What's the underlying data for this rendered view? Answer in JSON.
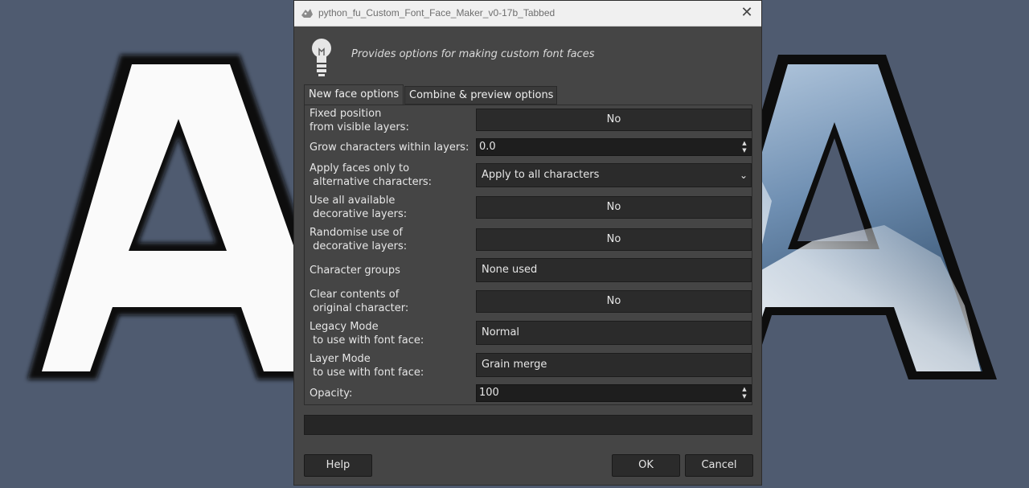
{
  "window": {
    "title": "python_fu_Custom_Font_Face_Maker_v0-17b_Tabbed",
    "close_glyph": "✕"
  },
  "header": {
    "description": "Provides options for making custom font faces"
  },
  "tabs": [
    {
      "label": "New face options",
      "active": true
    },
    {
      "label": "Combine & preview options",
      "active": false
    }
  ],
  "form": {
    "fixed_position": {
      "label": "Fixed position\nfrom visible layers:",
      "value": "No"
    },
    "grow_characters": {
      "label": "Grow characters within layers:",
      "value": "0.0"
    },
    "apply_faces": {
      "label": "Apply faces only to\n alternative characters:",
      "value": "Apply to all characters"
    },
    "use_all_decorative": {
      "label": "Use all available\n decorative layers:",
      "value": "No"
    },
    "randomise_decorative": {
      "label": "Randomise use of\n decorative layers:",
      "value": "No"
    },
    "character_groups": {
      "label": "Character groups",
      "value": "None used"
    },
    "clear_contents": {
      "label": "Clear contents of\n original character:",
      "value": "No"
    },
    "legacy_mode": {
      "label": "Legacy Mode\n to use with font face:",
      "value": "Normal"
    },
    "layer_mode": {
      "label": "Layer Mode\n to use with font face:",
      "value": "Grain merge"
    },
    "opacity": {
      "label": "Opacity:",
      "value": "100"
    }
  },
  "buttons": {
    "help": "Help",
    "ok": "OK",
    "cancel": "Cancel"
  },
  "colors": {
    "background": "#4f5b70",
    "dialog": "#454545"
  }
}
